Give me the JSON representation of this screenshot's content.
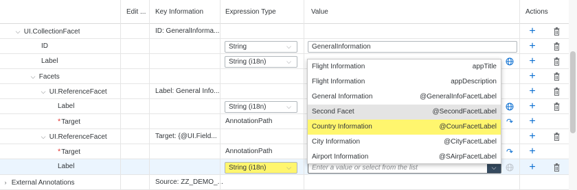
{
  "header": {
    "edit": "Edit ...",
    "key_information": "Key Information",
    "expression_type": "Expression Type",
    "value": "Value",
    "actions": "Actions"
  },
  "rows": [
    {
      "term": "UI.CollectionFacet",
      "key": "ID: GeneralInforma...",
      "expr": "",
      "value": ""
    },
    {
      "term": "ID",
      "key": "",
      "expr": "String",
      "value": "GeneralInformation"
    },
    {
      "term": "Label",
      "key": "",
      "expr": "String (i18n)",
      "value": ""
    },
    {
      "term": "Facets",
      "key": "",
      "expr": "",
      "value": ""
    },
    {
      "term": "UI.ReferenceFacet",
      "key": "Label: General Info...",
      "expr": "",
      "value": ""
    },
    {
      "term": "Label",
      "key": "",
      "expr": "String (i18n)",
      "value": ""
    },
    {
      "term": "Target",
      "key": "",
      "expr": "AnnotationPath",
      "value": ""
    },
    {
      "term": "UI.ReferenceFacet",
      "key": "Target: {@UI.Field...",
      "expr": "",
      "value": ""
    },
    {
      "term": "Target",
      "key": "",
      "expr": "AnnotationPath",
      "value": ""
    },
    {
      "term": "Label",
      "key": "",
      "expr": "String (i18n)",
      "value": ""
    },
    {
      "term": "External Annotations",
      "key": "Source: ZZ_DEMO_...",
      "expr": "",
      "value": ""
    }
  ],
  "required_mark": "*",
  "value_input_placeholder": "Enter a value or select from the list",
  "dropdown_options": [
    {
      "label": "Flight Information",
      "key": "appTitle"
    },
    {
      "label": "Flight Information",
      "key": "appDescription"
    },
    {
      "label": "General Information",
      "key": "@GeneralInfoFacetLabel"
    },
    {
      "label": "Second Facet",
      "key": "@SecondFacetLabel"
    },
    {
      "label": "Country Information",
      "key": "@CounFacetLabel"
    },
    {
      "label": "City Information",
      "key": "@CityFacetLabel"
    },
    {
      "label": "Airport Information",
      "key": "@SAirpFacetLabel"
    }
  ],
  "icons": {
    "expand": "chevron-down-icon",
    "collapsed": "chevron-right-icon",
    "add": "plus-icon",
    "delete": "trash-icon",
    "translate": "globe-icon",
    "navigate": "goto-arrow-icon"
  },
  "colors": {
    "highlight": "#fff66e",
    "accent": "#0a6ed1",
    "required": "#e53935",
    "dropdown_button": "#354a5f"
  }
}
